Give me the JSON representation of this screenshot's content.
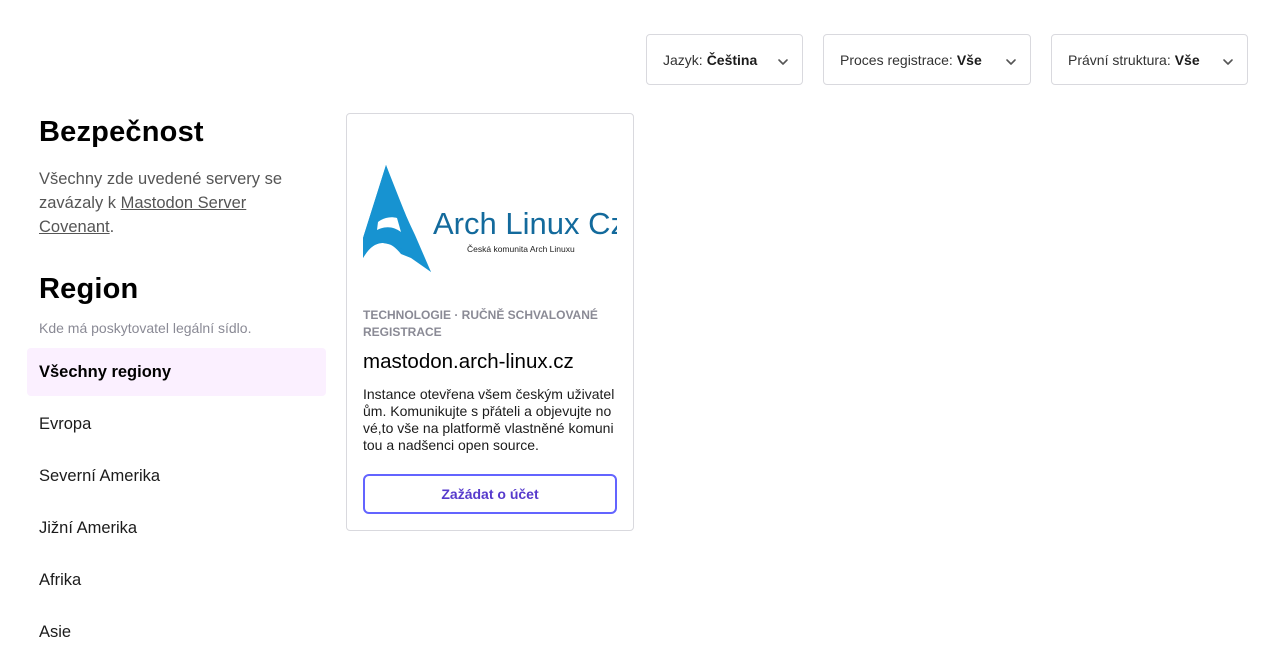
{
  "filters": {
    "language": {
      "label": "Jazyk:",
      "value": "Čeština"
    },
    "registration": {
      "label": "Proces registrace:",
      "value": "Vše"
    },
    "legal": {
      "label": "Právní struktura:",
      "value": "Vše"
    }
  },
  "sidebar": {
    "security": {
      "title": "Bezpečnost",
      "text_before": "Všechny zde uvedené servery se zavázaly k",
      "link": "Mastodon Server Covenant",
      "text_after": "."
    },
    "region": {
      "title": "Region",
      "hint": "Kde má poskytovatel legální sídlo.",
      "items": [
        {
          "label": "Všechny regiony",
          "active": true
        },
        {
          "label": "Evropa"
        },
        {
          "label": "Severní Amerika"
        },
        {
          "label": "Jižní Amerika"
        },
        {
          "label": "Afrika"
        },
        {
          "label": "Asie"
        }
      ]
    }
  },
  "server_card": {
    "logo": {
      "text": "Arch Linux Cz",
      "subtitle": "Česká komunita Arch Linuxu",
      "color": "#1793d1"
    },
    "meta": "Technologie · Ručně schvalované registrace",
    "domain": "mastodon.arch-linux.cz",
    "description": "Instance otevřena všem českým uživatelům. Komunikujte s přáteli a objevujte nové,to vše na platformě vlastněné komunitou a nadšenci open source.",
    "button": "Zažádat o účet",
    "accent": "#6364ff"
  }
}
